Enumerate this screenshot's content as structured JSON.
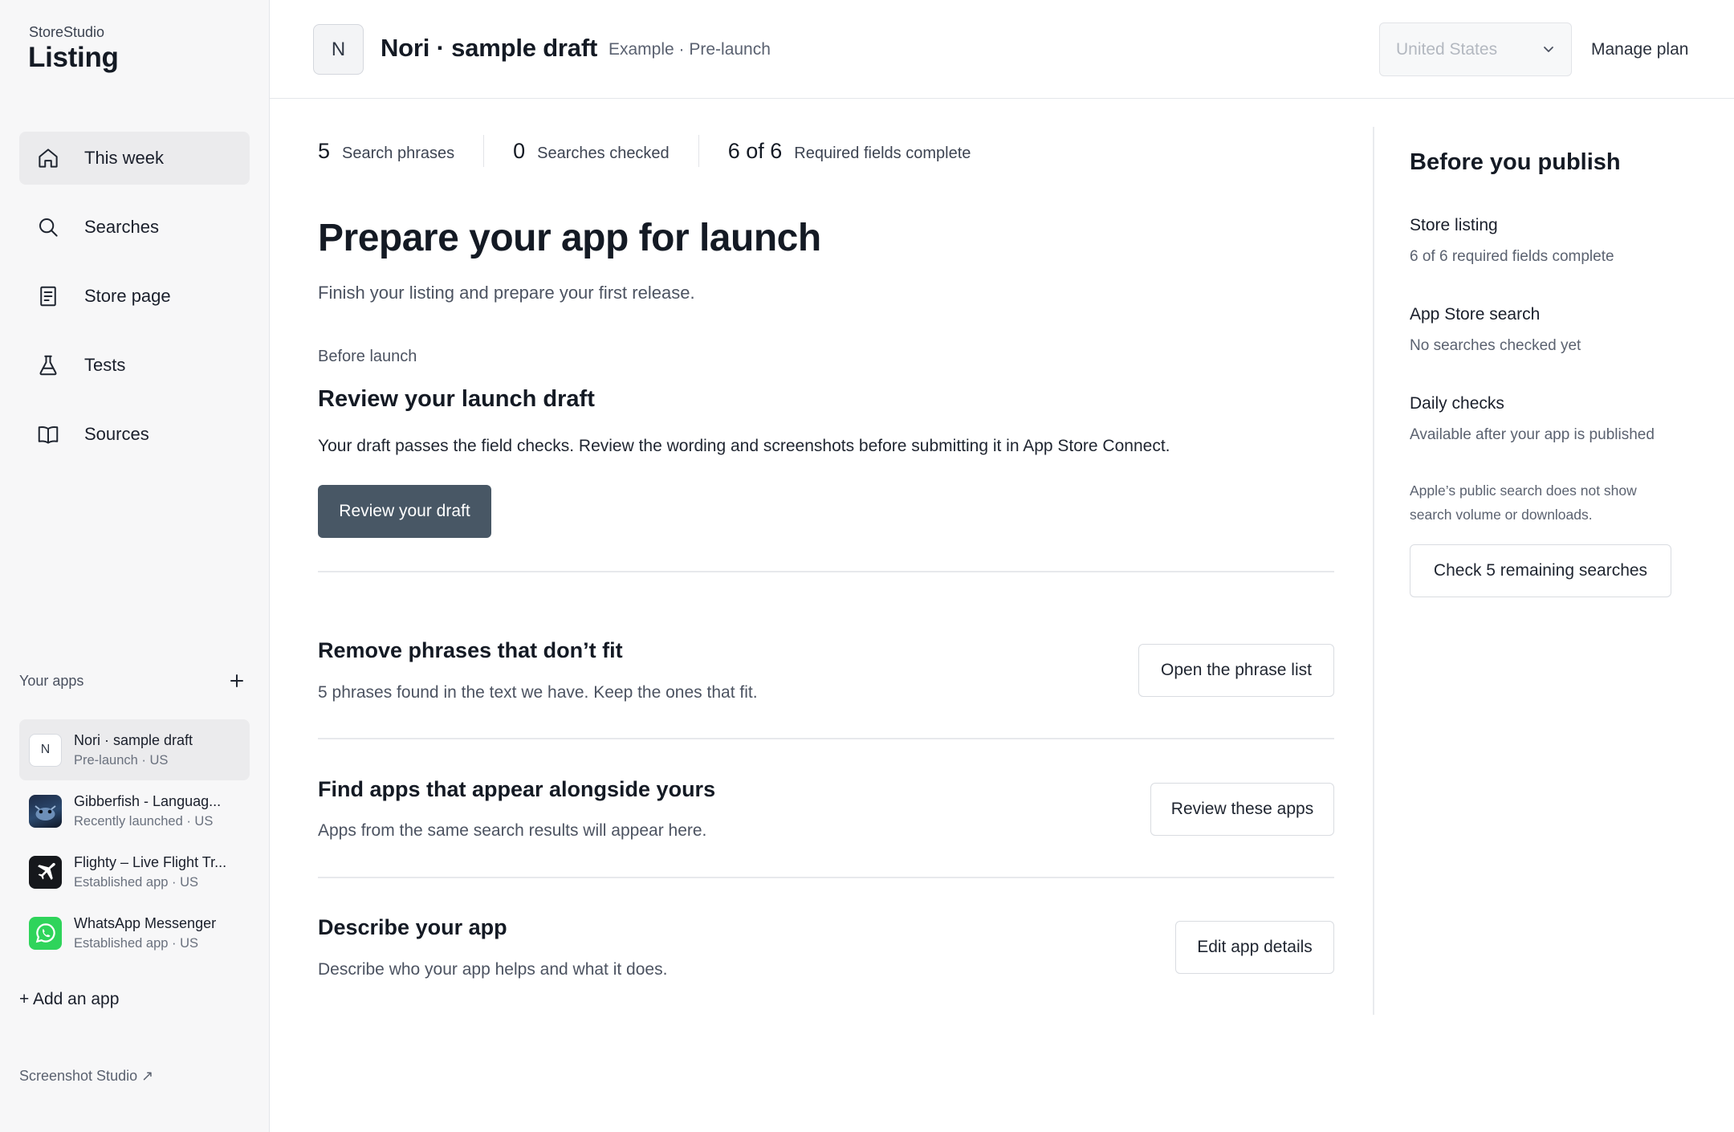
{
  "sidebar": {
    "brand_small": "StoreStudio",
    "brand_big": "Listing",
    "nav": [
      {
        "label": "This week",
        "icon": "home-icon",
        "active": true
      },
      {
        "label": "Searches",
        "icon": "search-icon"
      },
      {
        "label": "Store page",
        "icon": "document-icon"
      },
      {
        "label": "Tests",
        "icon": "flask-icon"
      },
      {
        "label": "Sources",
        "icon": "book-icon"
      }
    ],
    "your_apps_label": "Your apps",
    "apps": [
      {
        "name": "Nori · sample draft",
        "sub": "Pre-launch · US",
        "letter": "N",
        "active": true
      },
      {
        "name": "Gibberfish - Languag...",
        "sub": "Recently launched · US"
      },
      {
        "name": "Flighty – Live Flight Tr...",
        "sub": "Established app · US"
      },
      {
        "name": "WhatsApp Messenger",
        "sub": "Established app · US"
      }
    ],
    "add_app": "+ Add an app",
    "studio_link": "Screenshot Studio ↗"
  },
  "topbar": {
    "avatar_letter": "N",
    "title": "Nori · sample draft",
    "subtitle": "Example · Pre-launch",
    "country_placeholder": "United States",
    "manage_plan": "Manage plan"
  },
  "stats": [
    {
      "value": "5",
      "label": "Search phrases"
    },
    {
      "value": "0",
      "label": "Searches checked"
    },
    {
      "value": "6 of 6",
      "label": "Required fields complete"
    }
  ],
  "main": {
    "heading": "Prepare your app for launch",
    "lead": "Finish your listing and prepare your first release.",
    "kicker": "Before launch",
    "review_title": "Review your launch draft",
    "review_body": "Your draft passes the field checks. Review the wording and screenshots before submitting it in App Store Connect.",
    "review_button": "Review your draft",
    "tasks": [
      {
        "title": "Remove phrases that don’t fit",
        "desc": "5 phrases found in the text we have. Keep the ones that fit.",
        "button": "Open the phrase list"
      },
      {
        "title": "Find apps that appear alongside yours",
        "desc": "Apps from the same search results will appear here.",
        "button": "Review these apps"
      },
      {
        "title": "Describe your app",
        "desc": "Describe who your app helps and what it does.",
        "button": "Edit app details"
      }
    ]
  },
  "right_panel": {
    "title": "Before you publish",
    "items": [
      {
        "heading": "Store listing",
        "status": "6 of 6 required fields complete"
      },
      {
        "heading": "App Store search",
        "status": "No searches checked yet"
      },
      {
        "heading": "Daily checks",
        "status": "Available after your app is published"
      }
    ],
    "note": "Apple’s public search does not show search volume or downloads.",
    "button": "Check 5 remaining searches"
  },
  "colors": {
    "primary_button": "#485765",
    "sidebar_bg": "#f7f7f8",
    "active_item_bg": "#ebebed",
    "whatsapp_green": "#2fd45b"
  }
}
